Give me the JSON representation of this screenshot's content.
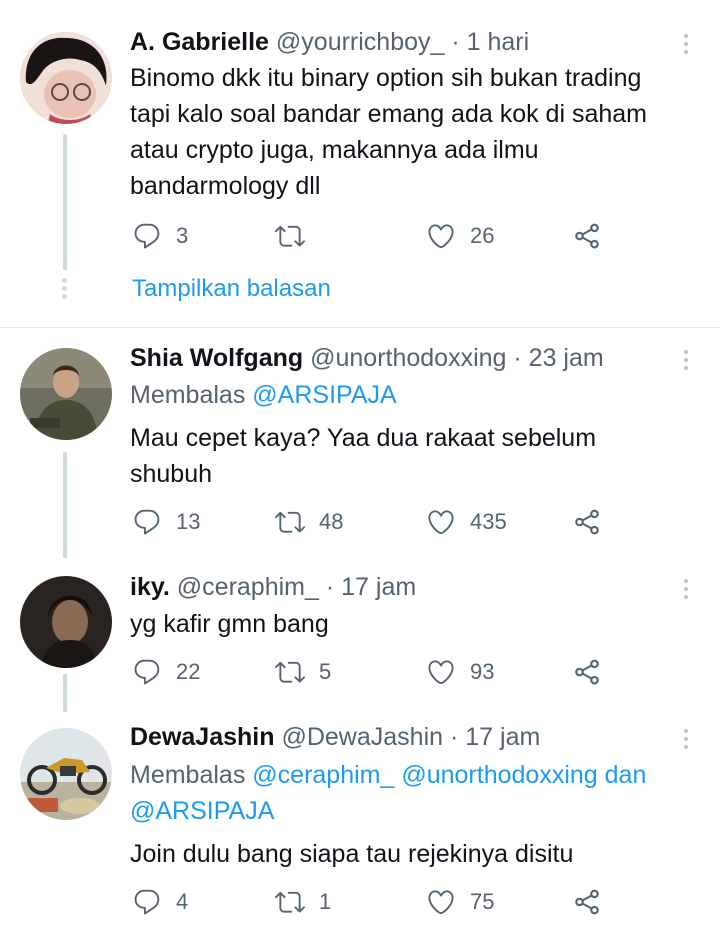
{
  "tweets": [
    {
      "name": "A. Gabrielle",
      "handle": "@yourrichboy_",
      "time": "· 1 hari",
      "text_lines": [
        "Binomo dkk itu binary option sih bukan trading",
        "tapi kalo soal bandar emang ada kok di saham",
        "atau crypto juga, makannya ada ilmu",
        "bandarmology dll"
      ],
      "replies": "3",
      "retweets": "",
      "likes": "26",
      "show_replies": "Tampilkan balasan"
    },
    {
      "name": "Shia Wolfgang",
      "handle": "@unorthodoxxing",
      "time": "· 23 jam",
      "replying_prefix": "Membalas",
      "replying_mentions": "@ARSIPAJA",
      "text_lines": [
        "Mau cepet kaya? Yaa dua rakaat sebelum",
        "shubuh"
      ],
      "replies": "13",
      "retweets": "48",
      "likes": "435"
    },
    {
      "name": "iky.",
      "handle": "@ceraphim_",
      "time": "· 17 jam",
      "text_lines": [
        "yg kafir gmn bang"
      ],
      "replies": "22",
      "retweets": "5",
      "likes": "93"
    },
    {
      "name": "DewaJashin",
      "handle": "@DewaJashin",
      "time": "· 17 jam",
      "replying_prefix": "Membalas",
      "replying_mention_1": "@ceraphim_",
      "replying_mention_2": "@unorthodoxxing",
      "replying_join": "dan",
      "replying_mention_3": "@ARSIPAJA",
      "text_lines": [
        "Join dulu bang siapa tau rejekinya disitu"
      ],
      "replies": "4",
      "retweets": "1",
      "likes": "75"
    }
  ],
  "icons": {
    "reply": "reply-icon",
    "retweet": "retweet-icon",
    "like": "heart-icon",
    "share": "share-icon",
    "more": "more-vertical-icon"
  },
  "colors": {
    "link": "#1d9bf0",
    "muted": "#536471",
    "text": "#0f1419"
  }
}
